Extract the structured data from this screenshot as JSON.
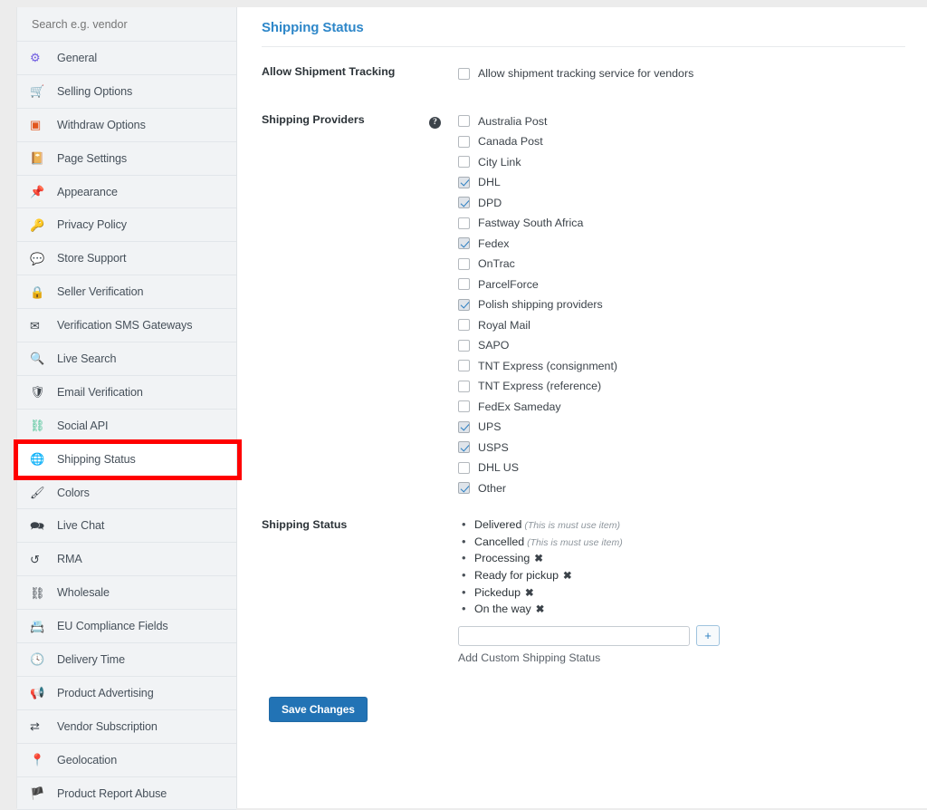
{
  "search": {
    "placeholder": "Search e.g. vendor",
    "value": ""
  },
  "sidebar": {
    "items": [
      {
        "label": "General",
        "icon": "gear-icon",
        "glyph": "⚙",
        "color": "#6f5ce0",
        "active": false
      },
      {
        "label": "Selling Options",
        "icon": "cart-icon",
        "glyph": "🛒",
        "color": "#2f9ee8",
        "active": false
      },
      {
        "label": "Withdraw Options",
        "icon": "withdraw-card-icon",
        "glyph": "▣",
        "color": "#e2571e",
        "active": false
      },
      {
        "label": "Page Settings",
        "icon": "book-icon",
        "glyph": "📔",
        "color": "#8f3fc9",
        "active": false
      },
      {
        "label": "Appearance",
        "icon": "pin-icon",
        "glyph": "📌",
        "color": "#2f9ee8",
        "active": false
      },
      {
        "label": "Privacy Policy",
        "icon": "key-icon",
        "glyph": "🔑",
        "color": "#3c434a",
        "active": false
      },
      {
        "label": "Store Support",
        "icon": "chat-bubble-icon",
        "glyph": "💬",
        "color": "#3c434a",
        "active": false
      },
      {
        "label": "Seller Verification",
        "icon": "lock-icon",
        "glyph": "🔒",
        "color": "#3c434a",
        "active": false
      },
      {
        "label": "Verification SMS Gateways",
        "icon": "envelope-icon",
        "glyph": "✉",
        "color": "#3c434a",
        "active": false
      },
      {
        "label": "Live Search",
        "icon": "search-icon",
        "glyph": "🔍",
        "color": "#3c434a",
        "active": false
      },
      {
        "label": "Email Verification",
        "icon": "shield-icon",
        "glyph": "🛡",
        "color": "#3c434a",
        "active": false
      },
      {
        "label": "Social API",
        "icon": "sitemap-icon",
        "glyph": "⛓",
        "color": "#3fbf8f",
        "active": false
      },
      {
        "label": "Shipping Status",
        "icon": "globe-icon",
        "glyph": "🌐",
        "color": "#3c434a",
        "active": true
      },
      {
        "label": "Colors",
        "icon": "paintbrush-icon",
        "glyph": "🖌",
        "color": "#3c434a",
        "active": false
      },
      {
        "label": "Live Chat",
        "icon": "chat-dual-icon",
        "glyph": "🗪",
        "color": "#3c434a",
        "active": false
      },
      {
        "label": "RMA",
        "icon": "undo-arrow-icon",
        "glyph": "↺",
        "color": "#3c434a",
        "active": false
      },
      {
        "label": "Wholesale",
        "icon": "hierarchy-icon",
        "glyph": "⛓",
        "color": "#3c434a",
        "active": false
      },
      {
        "label": "EU Compliance Fields",
        "icon": "id-card-icon",
        "glyph": "📇",
        "color": "#3c434a",
        "active": false
      },
      {
        "label": "Delivery Time",
        "icon": "clock-icon",
        "glyph": "🕓",
        "color": "#3c434a",
        "active": false
      },
      {
        "label": "Product Advertising",
        "icon": "megaphone-icon",
        "glyph": "📢",
        "color": "#3c434a",
        "active": false
      },
      {
        "label": "Vendor Subscription",
        "icon": "recurring-icon",
        "glyph": "⇄",
        "color": "#3c434a",
        "active": false
      },
      {
        "label": "Geolocation",
        "icon": "map-pin-icon",
        "glyph": "📍",
        "color": "#3c434a",
        "active": false
      },
      {
        "label": "Product Report Abuse",
        "icon": "flag-icon",
        "glyph": "🏴",
        "color": "#3c434a",
        "active": false
      }
    ],
    "highlight_label": "Shipping Status",
    "highlight_color": "#ff0000"
  },
  "main": {
    "title": "Shipping Status",
    "accent_color": "#2e87c9",
    "allow_tracking": {
      "label": "Allow Shipment Tracking",
      "checkbox_label": "Allow shipment tracking service for vendors",
      "checked": false
    },
    "providers": {
      "label": "Shipping Providers",
      "help_glyph": "?",
      "items": [
        {
          "label": "Australia Post",
          "checked": false
        },
        {
          "label": "Canada Post",
          "checked": false
        },
        {
          "label": "City Link",
          "checked": false
        },
        {
          "label": "DHL",
          "checked": true
        },
        {
          "label": "DPD",
          "checked": true
        },
        {
          "label": "Fastway South Africa",
          "checked": false
        },
        {
          "label": "Fedex",
          "checked": true
        },
        {
          "label": "OnTrac",
          "checked": false
        },
        {
          "label": "ParcelForce",
          "checked": false
        },
        {
          "label": "Polish shipping providers",
          "checked": true
        },
        {
          "label": "Royal Mail",
          "checked": false
        },
        {
          "label": "SAPO",
          "checked": false
        },
        {
          "label": "TNT Express (consignment)",
          "checked": false
        },
        {
          "label": "TNT Express (reference)",
          "checked": false
        },
        {
          "label": "FedEx Sameday",
          "checked": false
        },
        {
          "label": "UPS",
          "checked": true
        },
        {
          "label": "USPS",
          "checked": true
        },
        {
          "label": "DHL US",
          "checked": false
        },
        {
          "label": "Other",
          "checked": true
        }
      ]
    },
    "shipping_status": {
      "label": "Shipping Status",
      "items": [
        {
          "label": "Delivered",
          "note": "(This is must use item)",
          "removable": false
        },
        {
          "label": "Cancelled",
          "note": "(This is must use item)",
          "removable": false
        },
        {
          "label": "Processing",
          "note": "",
          "removable": true
        },
        {
          "label": "Ready for pickup",
          "note": "",
          "removable": true
        },
        {
          "label": "Pickedup",
          "note": "",
          "removable": true
        },
        {
          "label": "On the way",
          "note": "",
          "removable": true
        }
      ],
      "remove_glyph": "✖",
      "add_input_value": "",
      "add_input_placeholder": "",
      "add_button_glyph": "+",
      "add_caption": "Add Custom Shipping Status"
    },
    "save_label": "Save Changes"
  }
}
